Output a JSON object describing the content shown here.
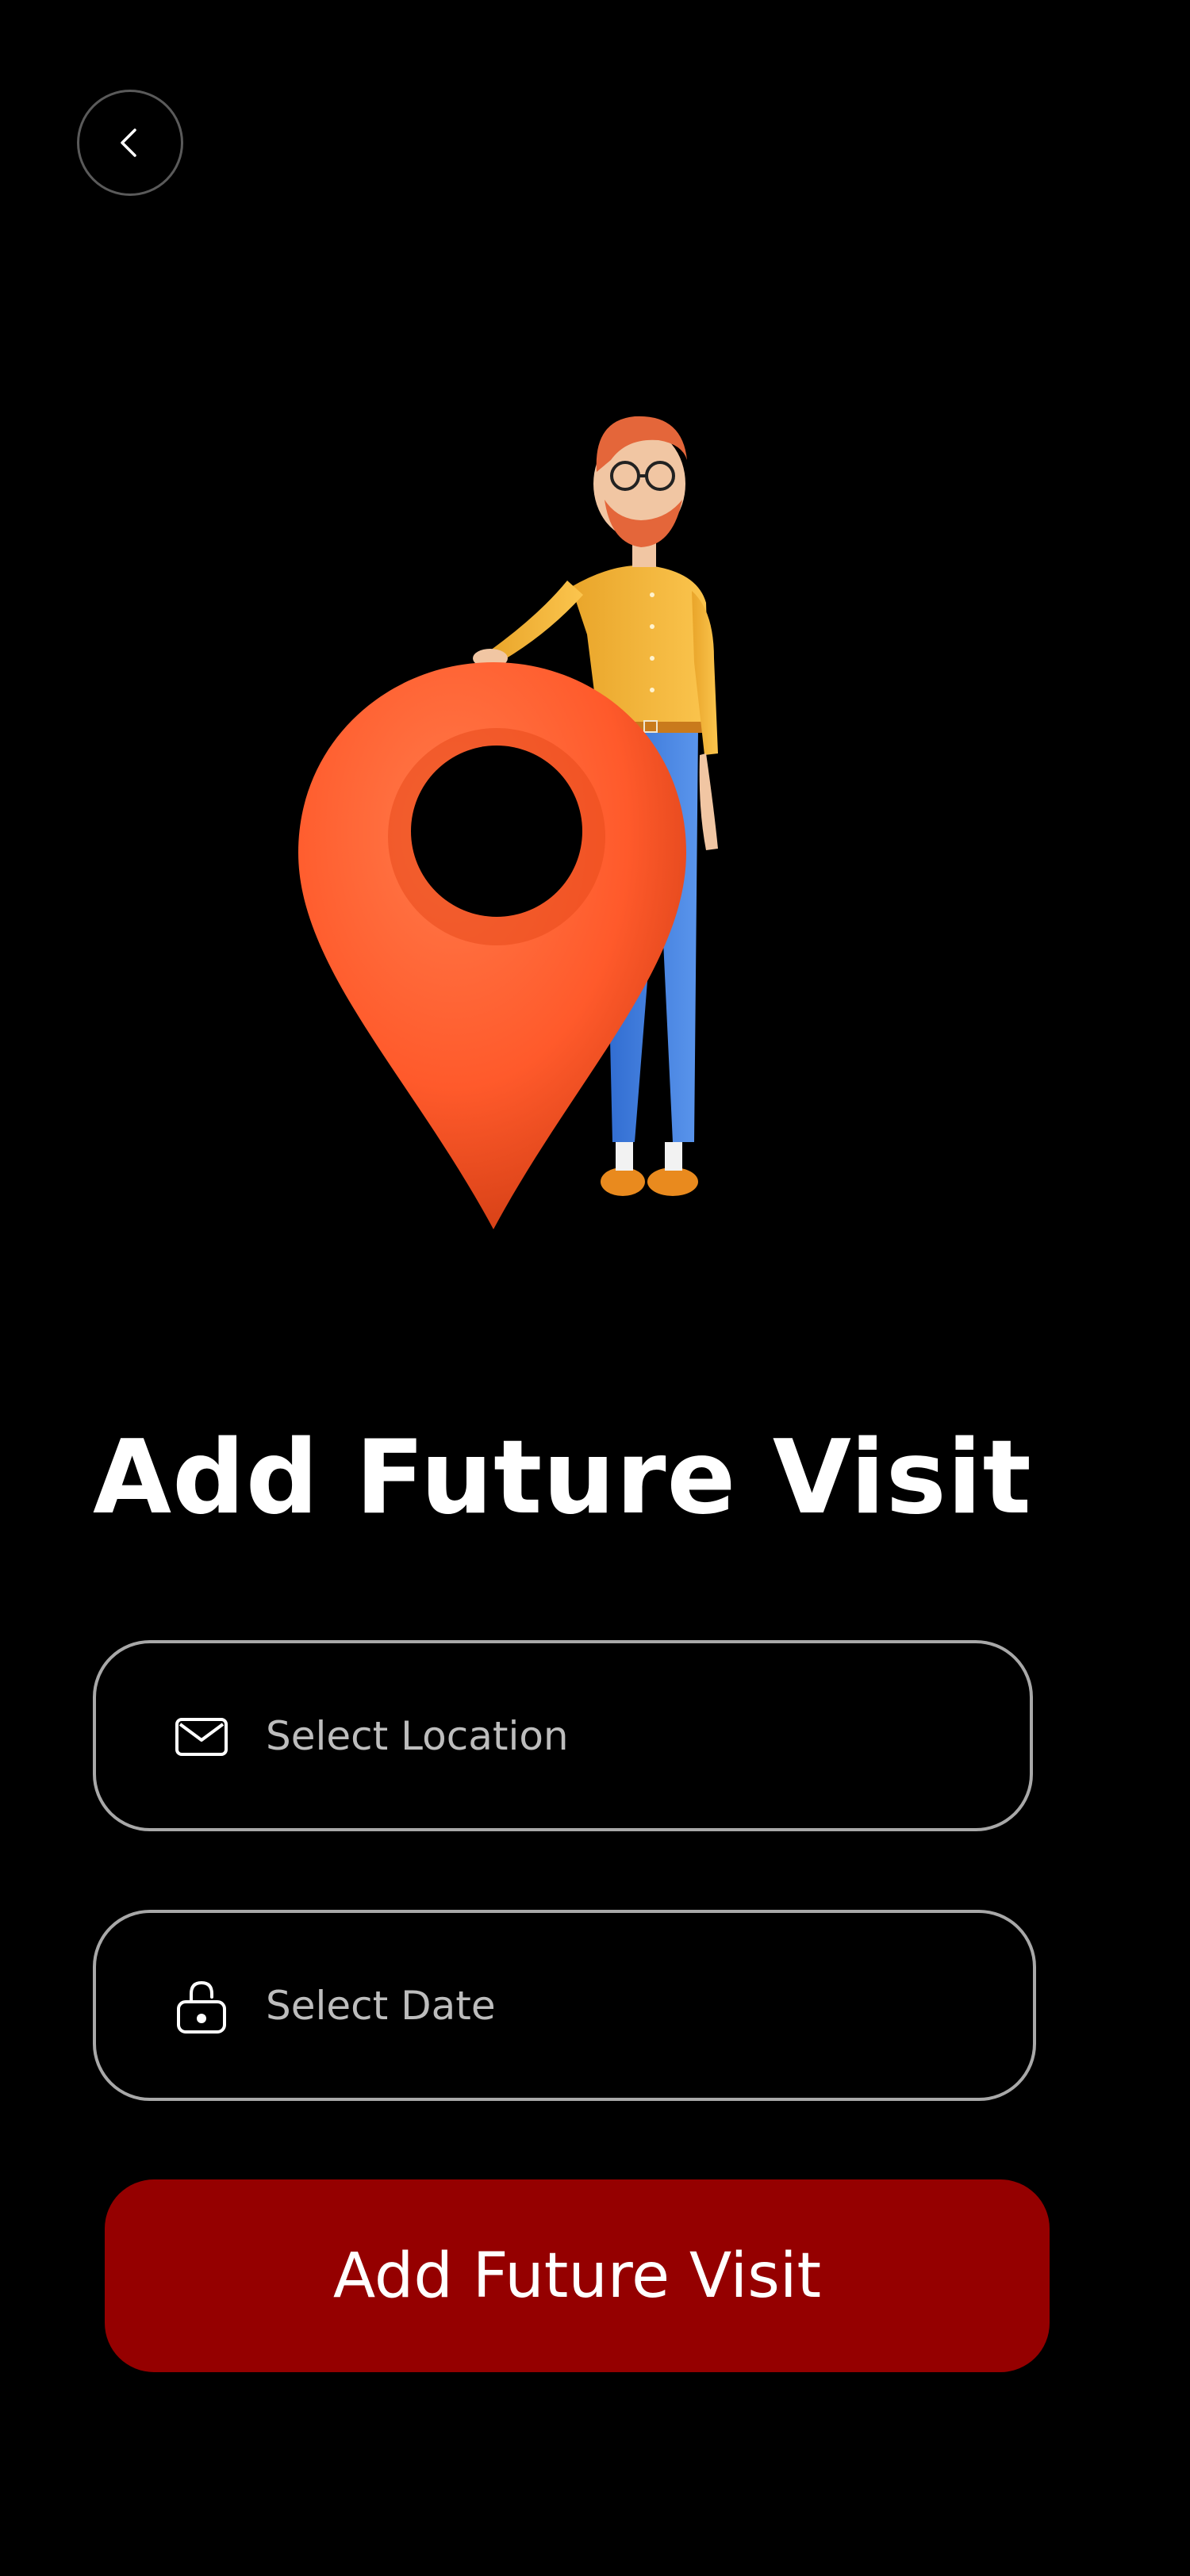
{
  "header": {
    "back_icon": "chevron-left-icon"
  },
  "hero": {
    "illustration": "person-with-location-pin-illustration",
    "colors": {
      "pin": "#FF5A2B",
      "shirt": "#F6B73C",
      "pants": "#3E7FE0",
      "hair": "#E4663A"
    }
  },
  "page": {
    "title": "Add Future Visit"
  },
  "form": {
    "location": {
      "icon": "envelope-icon",
      "placeholder": "Select Location",
      "value": ""
    },
    "date": {
      "icon": "lock-icon",
      "placeholder": "Select Date",
      "value": ""
    },
    "submit_label": "Add Future Visit"
  },
  "theme": {
    "background": "#000000",
    "accent": "#950000",
    "field_border": "#A8A8A8",
    "text": "#FFFFFF"
  }
}
